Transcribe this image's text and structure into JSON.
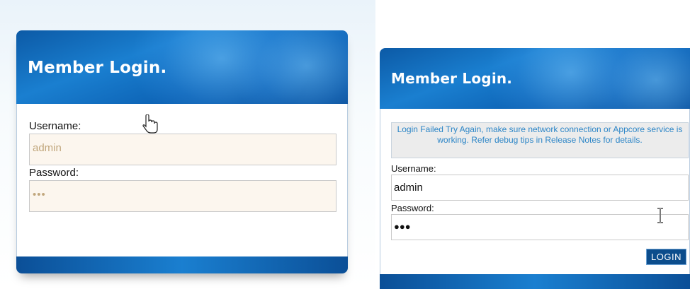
{
  "left_panel": {
    "title": "Member Login.",
    "username_label": "Username:",
    "username_value": "admin",
    "password_label": "Password:",
    "password_value": "•••"
  },
  "right_panel": {
    "title": "Member Login.",
    "error_message": "Login Failed Try Again, make sure network connection or Appcore service is working. Refer debug tips in Release Notes for details.",
    "username_label": "Username:",
    "username_value": "admin",
    "password_label": "Password:",
    "password_value": "●●●",
    "login_button": "LOGIN"
  },
  "icons": {
    "left_cursor": "hand-pointer-icon",
    "right_cursor": "text-ibeam-icon"
  },
  "colors": {
    "header_blue": "#0c5aa6",
    "error_text": "#2d86c7",
    "button_bg": "#0c4d8c"
  }
}
